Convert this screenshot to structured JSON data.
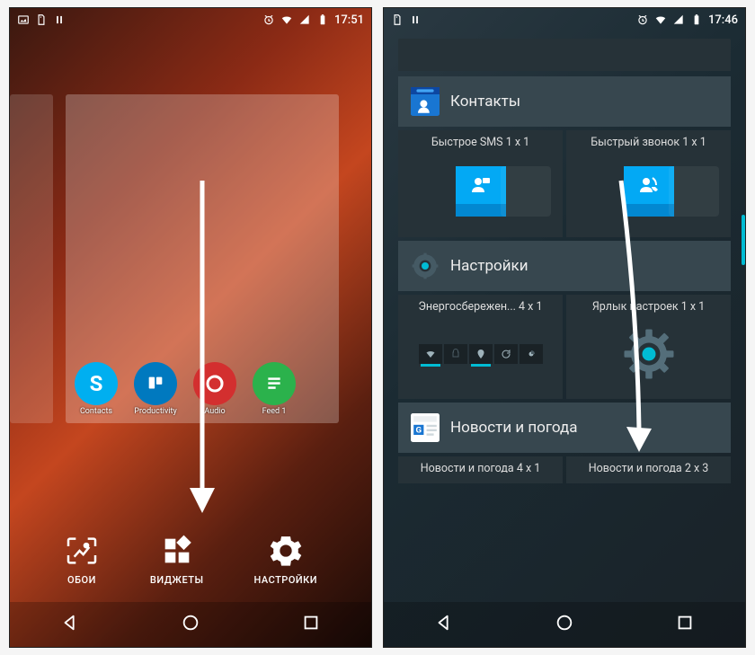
{
  "left": {
    "status_time": "17:51",
    "preview_icons": [
      {
        "label": "Contacts",
        "bg": "#00aff0",
        "glyph": "S"
      },
      {
        "label": "Productivity",
        "bg": "#0079bf",
        "glyph": "▮▮"
      },
      {
        "label": "Audio",
        "bg": "#d32f2f",
        "glyph": "◐"
      },
      {
        "label": "Feed 1",
        "bg": "#2bb24c",
        "glyph": "▤"
      }
    ],
    "menu": {
      "wallpapers": "ОБОИ",
      "widgets": "ВИДЖЕТЫ",
      "settings": "НАСТРОЙКИ"
    }
  },
  "right": {
    "status_time": "17:46",
    "sections": {
      "contacts": {
        "title": "Контакты",
        "items": [
          {
            "label": "Быстрое SMS 1 x 1"
          },
          {
            "label": "Быстрый звонок 1 x 1"
          }
        ]
      },
      "settings": {
        "title": "Настройки",
        "items": [
          {
            "label": "Энергосбережен... 4 x 1"
          },
          {
            "label": "Ярлык настроек 1 x 1"
          }
        ]
      },
      "news": {
        "title": "Новости и погода",
        "items": [
          {
            "label": "Новости и погода 4 x 1"
          },
          {
            "label": "Новости и погода 2 x 3"
          }
        ]
      }
    }
  }
}
